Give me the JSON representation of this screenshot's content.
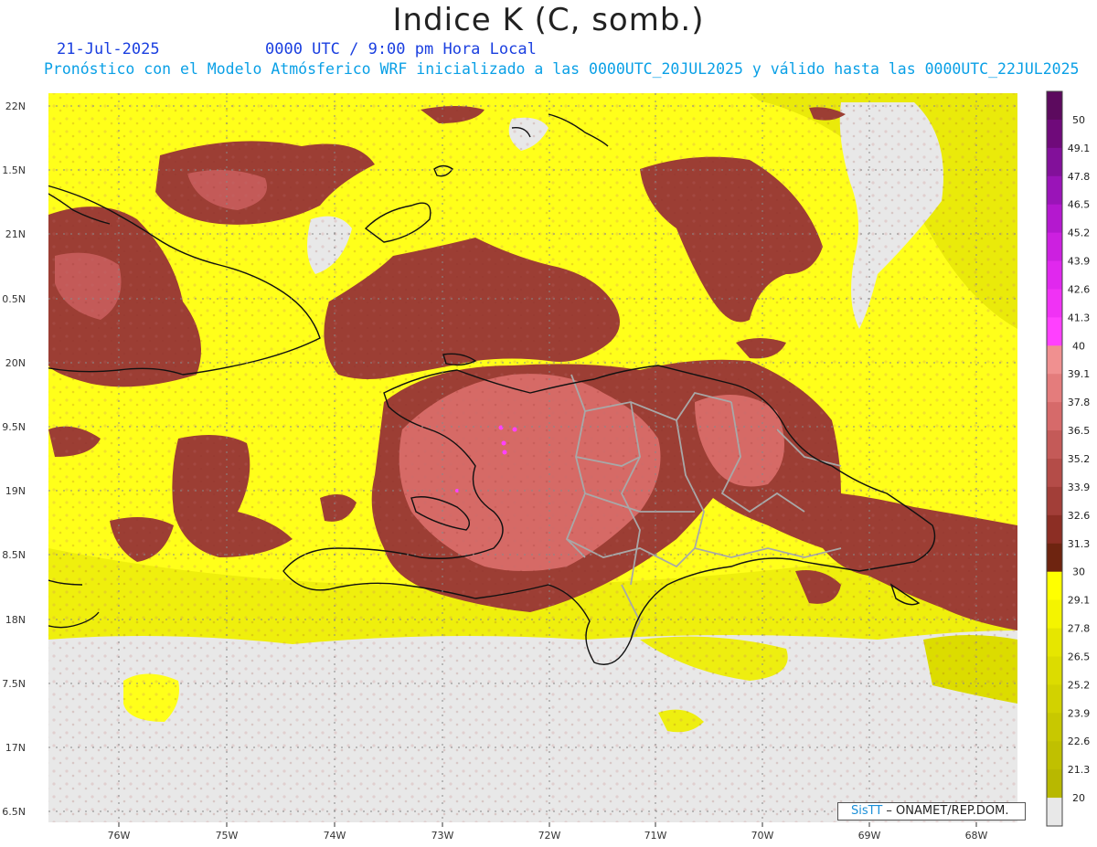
{
  "header": {
    "title": "Indice K (C, somb.)",
    "date": "21-Jul-2025",
    "time": "0000 UTC / 9:00 pm Hora Local",
    "forecast": "Pronóstico con el Modelo Atmósferico WRF inicializado a las 0000UTC_20JUL2025 y válido hasta las  0000UTC_22JUL2025"
  },
  "axes": {
    "lat_labels": [
      "22N",
      "1.5N",
      "21N",
      "0.5N",
      "20N",
      "9.5N",
      "19N",
      "8.5N",
      "18N",
      "7.5N",
      "17N",
      "6.5N"
    ],
    "lon_labels": [
      "76W",
      "75W",
      "74W",
      "73W",
      "72W",
      "71W",
      "70W",
      "69W",
      "68W"
    ]
  },
  "legend": {
    "values": [
      "50",
      "49.1",
      "47.8",
      "46.5",
      "45.2",
      "43.9",
      "42.6",
      "41.3",
      "40",
      "39.1",
      "37.8",
      "36.5",
      "35.2",
      "33.9",
      "32.6",
      "31.3",
      "30",
      "29.1",
      "27.8",
      "26.5",
      "25.2",
      "23.9",
      "22.6",
      "21.3",
      "20"
    ],
    "colors": [
      "#5c0a5e",
      "#6f0a7a",
      "#82109a",
      "#9a14b8",
      "#b418cf",
      "#cc20e0",
      "#e028ee",
      "#f032f5",
      "#ff40ff",
      "#f09090",
      "#e47c7c",
      "#d66a6a",
      "#c45a58",
      "#b44c48",
      "#a23e38",
      "#8c2e24",
      "#6e2410",
      "#ffff00",
      "#f4f400",
      "#e6e600",
      "#dcdc00",
      "#d2d200",
      "#c8c800",
      "#c0c000",
      "#b8b800",
      "#e8e8e8"
    ]
  },
  "colors": {
    "background_field": "#ffff1a",
    "no_data": "#e8e8e8",
    "high_k": "#9c3e34",
    "very_high_k": "#d66a66",
    "coast": "#111111",
    "provinces": "#a8a8a8"
  },
  "credit": {
    "brand": "SisTT",
    "org": " – ONAMET/REP.DOM."
  }
}
